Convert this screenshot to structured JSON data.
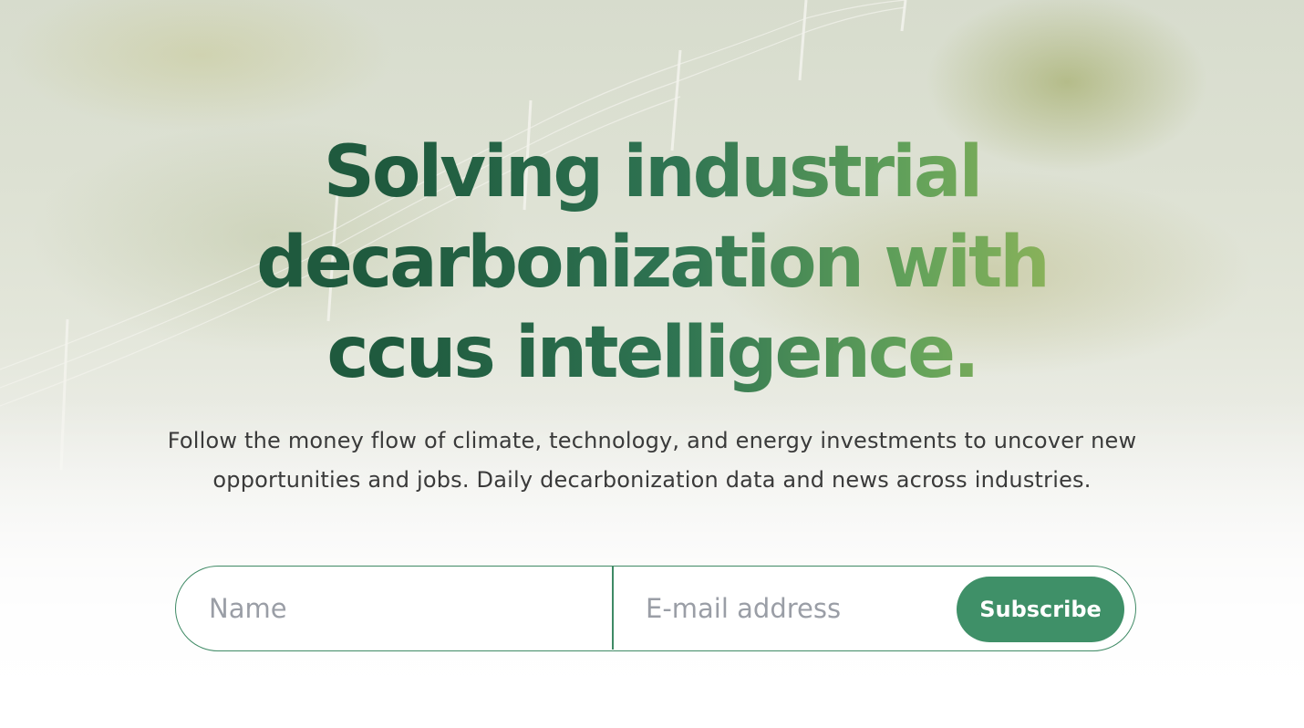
{
  "hero": {
    "headline_lines": [
      "Solving industrial",
      "decarbonization with",
      "ccus intelligence."
    ],
    "subtitle_lines": [
      "Follow the money flow of climate, technology, and energy investments to uncover new",
      "opportunities and jobs. Daily decarbonization data and news across industries."
    ]
  },
  "form": {
    "name_placeholder": "Name",
    "email_placeholder": "E-mail address",
    "subscribe_label": "Subscribe"
  },
  "colors": {
    "headline_dark": "#1f5a3e",
    "headline_light": "#8fb45a",
    "accent": "#3f9068",
    "form_border": "#3f8a65"
  }
}
